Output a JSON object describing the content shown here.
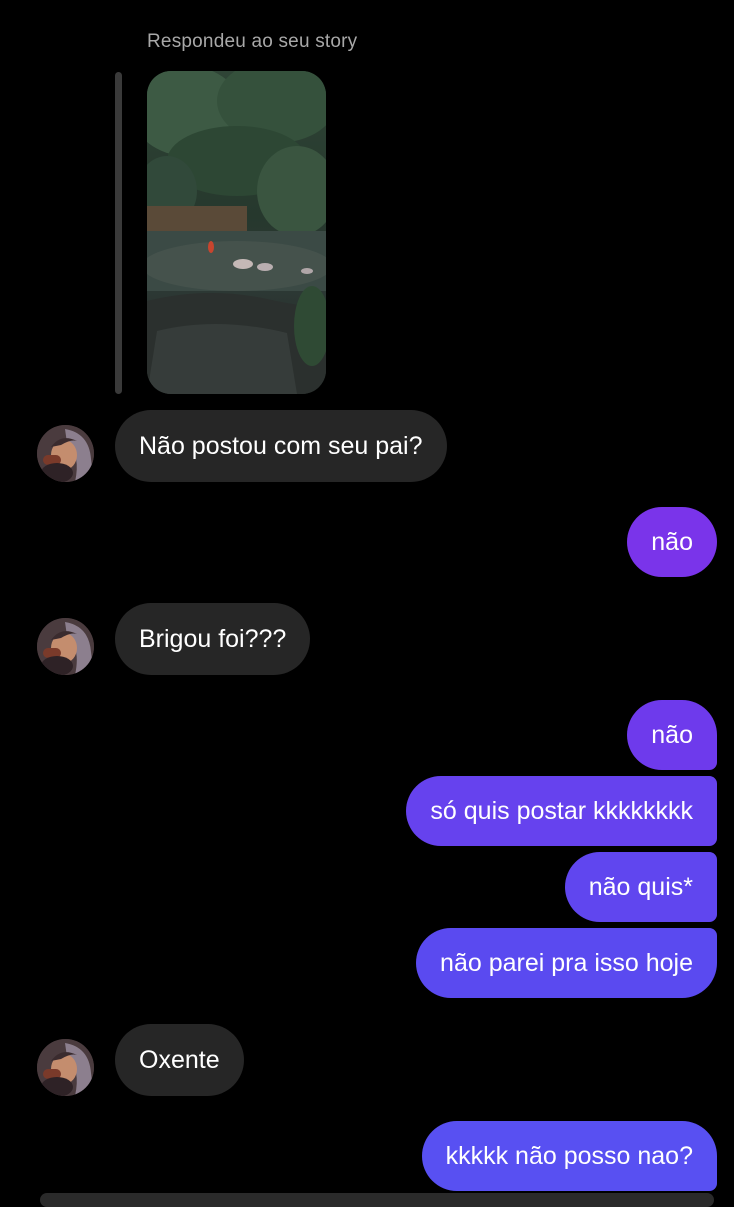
{
  "story_reply": {
    "caption": "Respondeu ao seu story",
    "thumbnail": "story-image"
  },
  "colors": {
    "background": "#000000",
    "incoming_bubble": "#262626",
    "outgoing_gradient": [
      "#8a3be8",
      "#5a50f0"
    ]
  },
  "messages": [
    {
      "sender": "contact",
      "text": "Não postou com seu pai?"
    },
    {
      "sender": "me",
      "text": "não"
    },
    {
      "sender": "contact",
      "text": "Brigou foi???"
    },
    {
      "sender": "me",
      "text": "não"
    },
    {
      "sender": "me",
      "text": "só quis postar kkkkkkkk"
    },
    {
      "sender": "me",
      "text": "não quis*"
    },
    {
      "sender": "me",
      "text": "não parei pra isso hoje"
    },
    {
      "sender": "contact",
      "text": "Oxente"
    },
    {
      "sender": "me",
      "text": "kkkkk não posso nao?"
    }
  ]
}
